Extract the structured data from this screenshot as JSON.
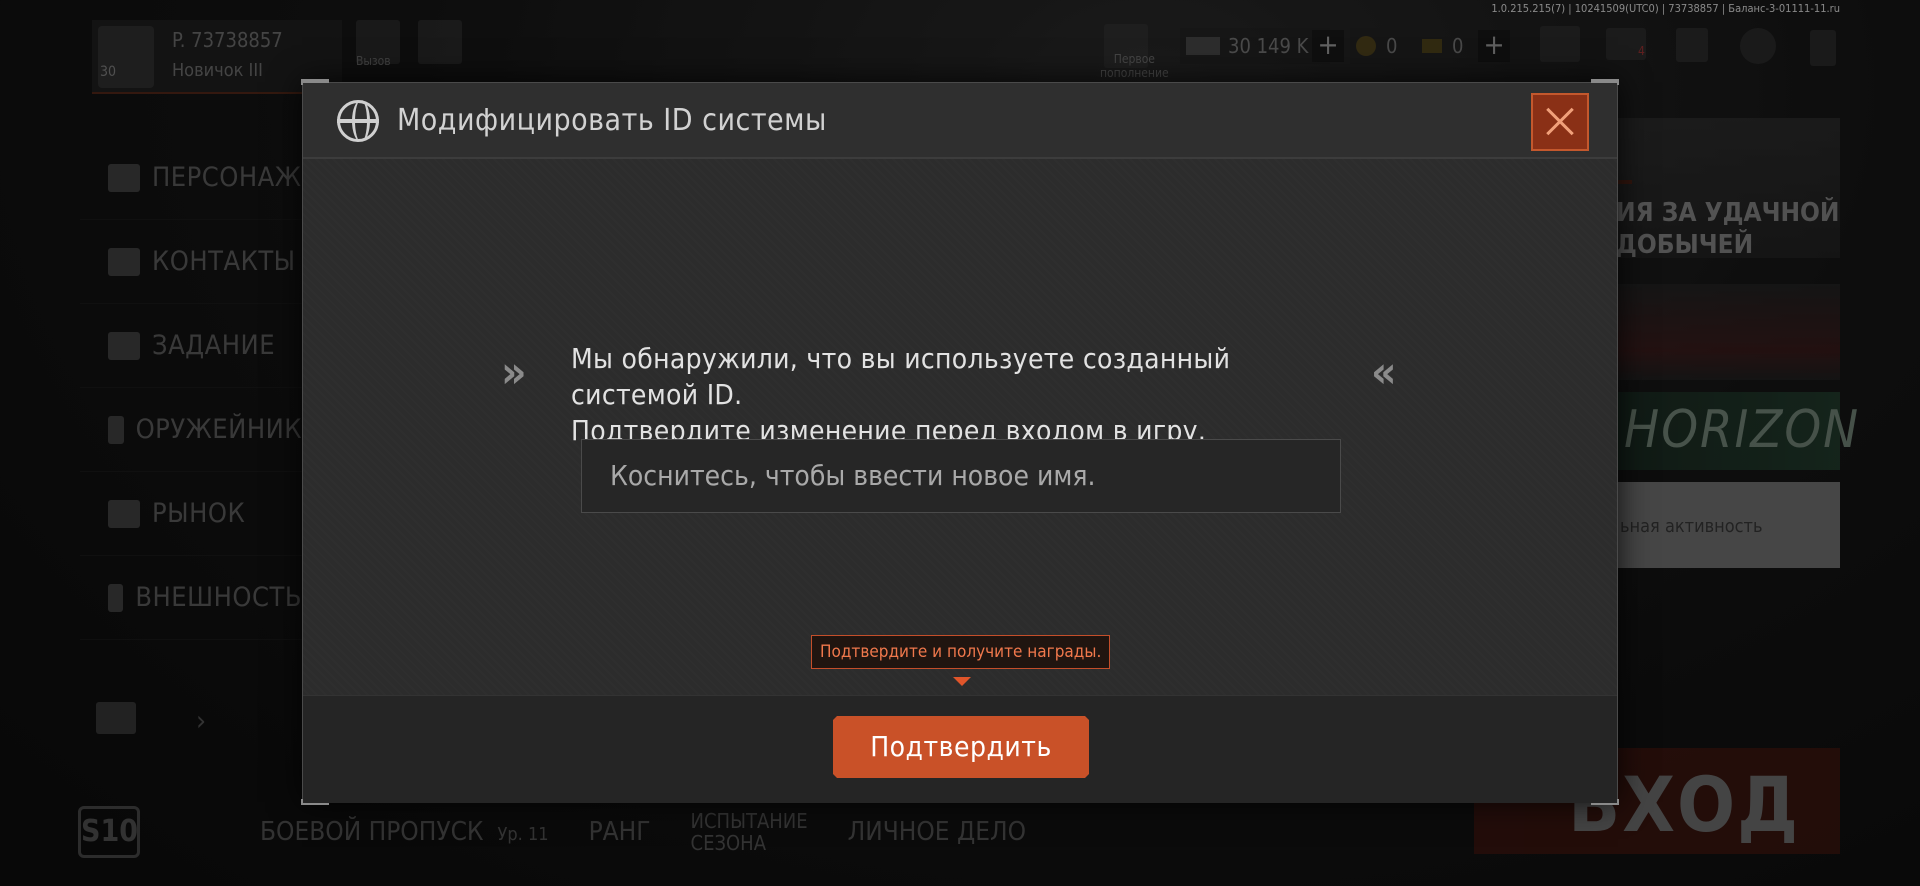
{
  "version_info": "1.0.215.215(7) | 10241509(UTC0) | 73738857 | Баланс-3-01111-11.ru",
  "profile": {
    "id": "P. 73738857",
    "level": "30",
    "rank": "Новичок III"
  },
  "top_bar": {
    "left_icon_label": "Вызов",
    "right_icon_label": "Первое\nпополнение",
    "currency_main": "30 149 K",
    "currency_coins": "0",
    "currency_gold": "0",
    "mail_badge": "4"
  },
  "side_menu": [
    {
      "label": "ПЕРСОНАЖ",
      "icon": "helmet-icon"
    },
    {
      "label": "КОНТАКТЫ",
      "icon": "contacts-icon"
    },
    {
      "label": "ЗАДАНИЕ",
      "icon": "task-icon"
    },
    {
      "label": "ОРУЖЕЙНИК",
      "icon": "gun-icon"
    },
    {
      "label": "РЫНОК",
      "icon": "market-icon"
    },
    {
      "label": "ВНЕШНОСТЬ",
      "icon": "appearance-icon"
    }
  ],
  "bottom_bar": {
    "season": "S10",
    "battle_pass": "БОЕВОЙ ПРОПУСК",
    "battle_pass_level": "Ур. 11",
    "rank": "РАНГ",
    "season_challenge": "ИСПЫТАНИЕ\nСЕЗОНА",
    "personal_file": "ЛИЧНОЕ ДЕЛО"
  },
  "banners": {
    "b1_tag": "",
    "b1_title_line1": "ИЯ ЗА УДАЧНОЙ",
    "b1_title_line2": "ДОБЫЧЕЙ",
    "b3_title": "HORIZON",
    "b4_title": "ьная активность"
  },
  "enter_label": "ВХОД",
  "dialog": {
    "title": "Модифицировать ID системы",
    "message_line1": "Мы обнаружили, что вы используете созданный системой ID.",
    "message_line2": "Подтвердите изменение перед входом в игру.",
    "input_placeholder": "Коснитесь, чтобы ввести новое имя.",
    "tip": "Подтвердите и получите награды.",
    "confirm_label": "Подтвердить"
  },
  "colors": {
    "accent": "#c95128",
    "dialog_bg": "#2c2c2c",
    "tip_text": "#f0784c"
  }
}
